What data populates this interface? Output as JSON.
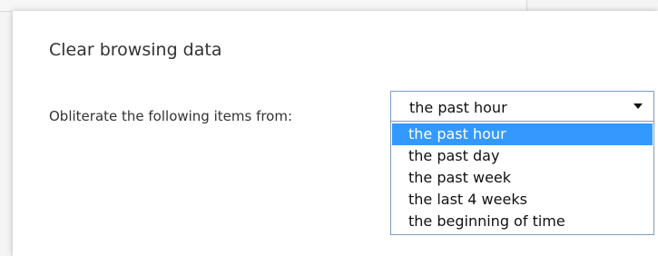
{
  "dialog": {
    "title": "Clear browsing data",
    "range_label": "Obliterate the following items from:",
    "select": {
      "value": "the past hour",
      "options": [
        "the past hour",
        "the past day",
        "the past week",
        "the last 4 weeks",
        "the beginning of time"
      ],
      "highlighted_index": 0
    }
  },
  "colors": {
    "highlight": "#3399ff",
    "dialog_bg": "#ffffff",
    "text": "#333333"
  }
}
